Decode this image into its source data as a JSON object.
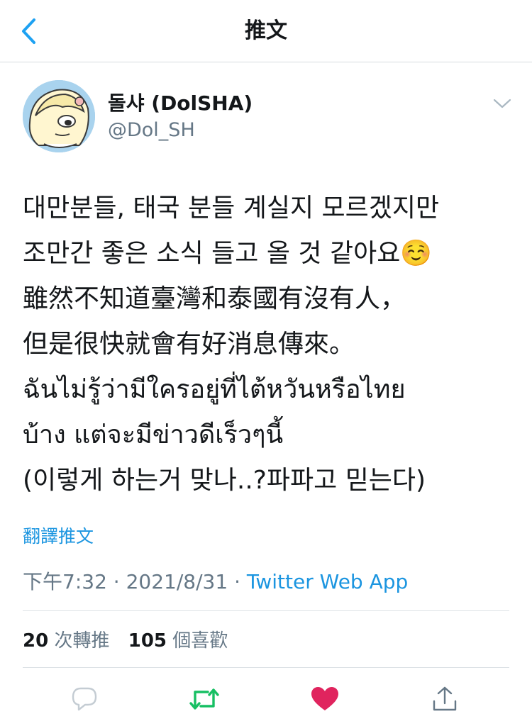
{
  "nav": {
    "title": "推文"
  },
  "tweet": {
    "author": {
      "display_name": "돌샤 (DolSHA)",
      "handle": "@Dol_SH"
    },
    "lines": [
      "대만분들, 태국 분들 계실지 모르겠지만",
      "조만간 좋은 소식 들고 올 것 같아요",
      "雖然不知道臺灣和泰國有沒有人，",
      "但是很快就會有好消息傳來。",
      "ฉันไม่รู้ว่ามีใครอยู่ที่ไต้หวันหรือไทย",
      "บ้าง แต่จะมีข่าวดีเร็วๆนี้",
      "(이렇게 하는거 맞나..?파파고 믿는다)"
    ],
    "emoji": "☺️",
    "translate_label": "翻譯推文",
    "time": "下午7:32",
    "date": "2021/8/31",
    "separator": "·",
    "source": "Twitter Web App",
    "retweet_count": "20",
    "retweet_label": "次轉推",
    "like_count": "105",
    "like_label": "個喜歡"
  },
  "icons": {
    "back": "chevron-left-icon",
    "more": "chevron-down-icon",
    "reply": "reply-bubble-icon",
    "retweet": "retweet-icon",
    "like": "heart-icon",
    "share": "share-icon"
  },
  "colors": {
    "accent": "#1b95e0",
    "retweet_active": "#17bf63",
    "like_active": "#e0245e",
    "secondary_text": "#657786"
  }
}
